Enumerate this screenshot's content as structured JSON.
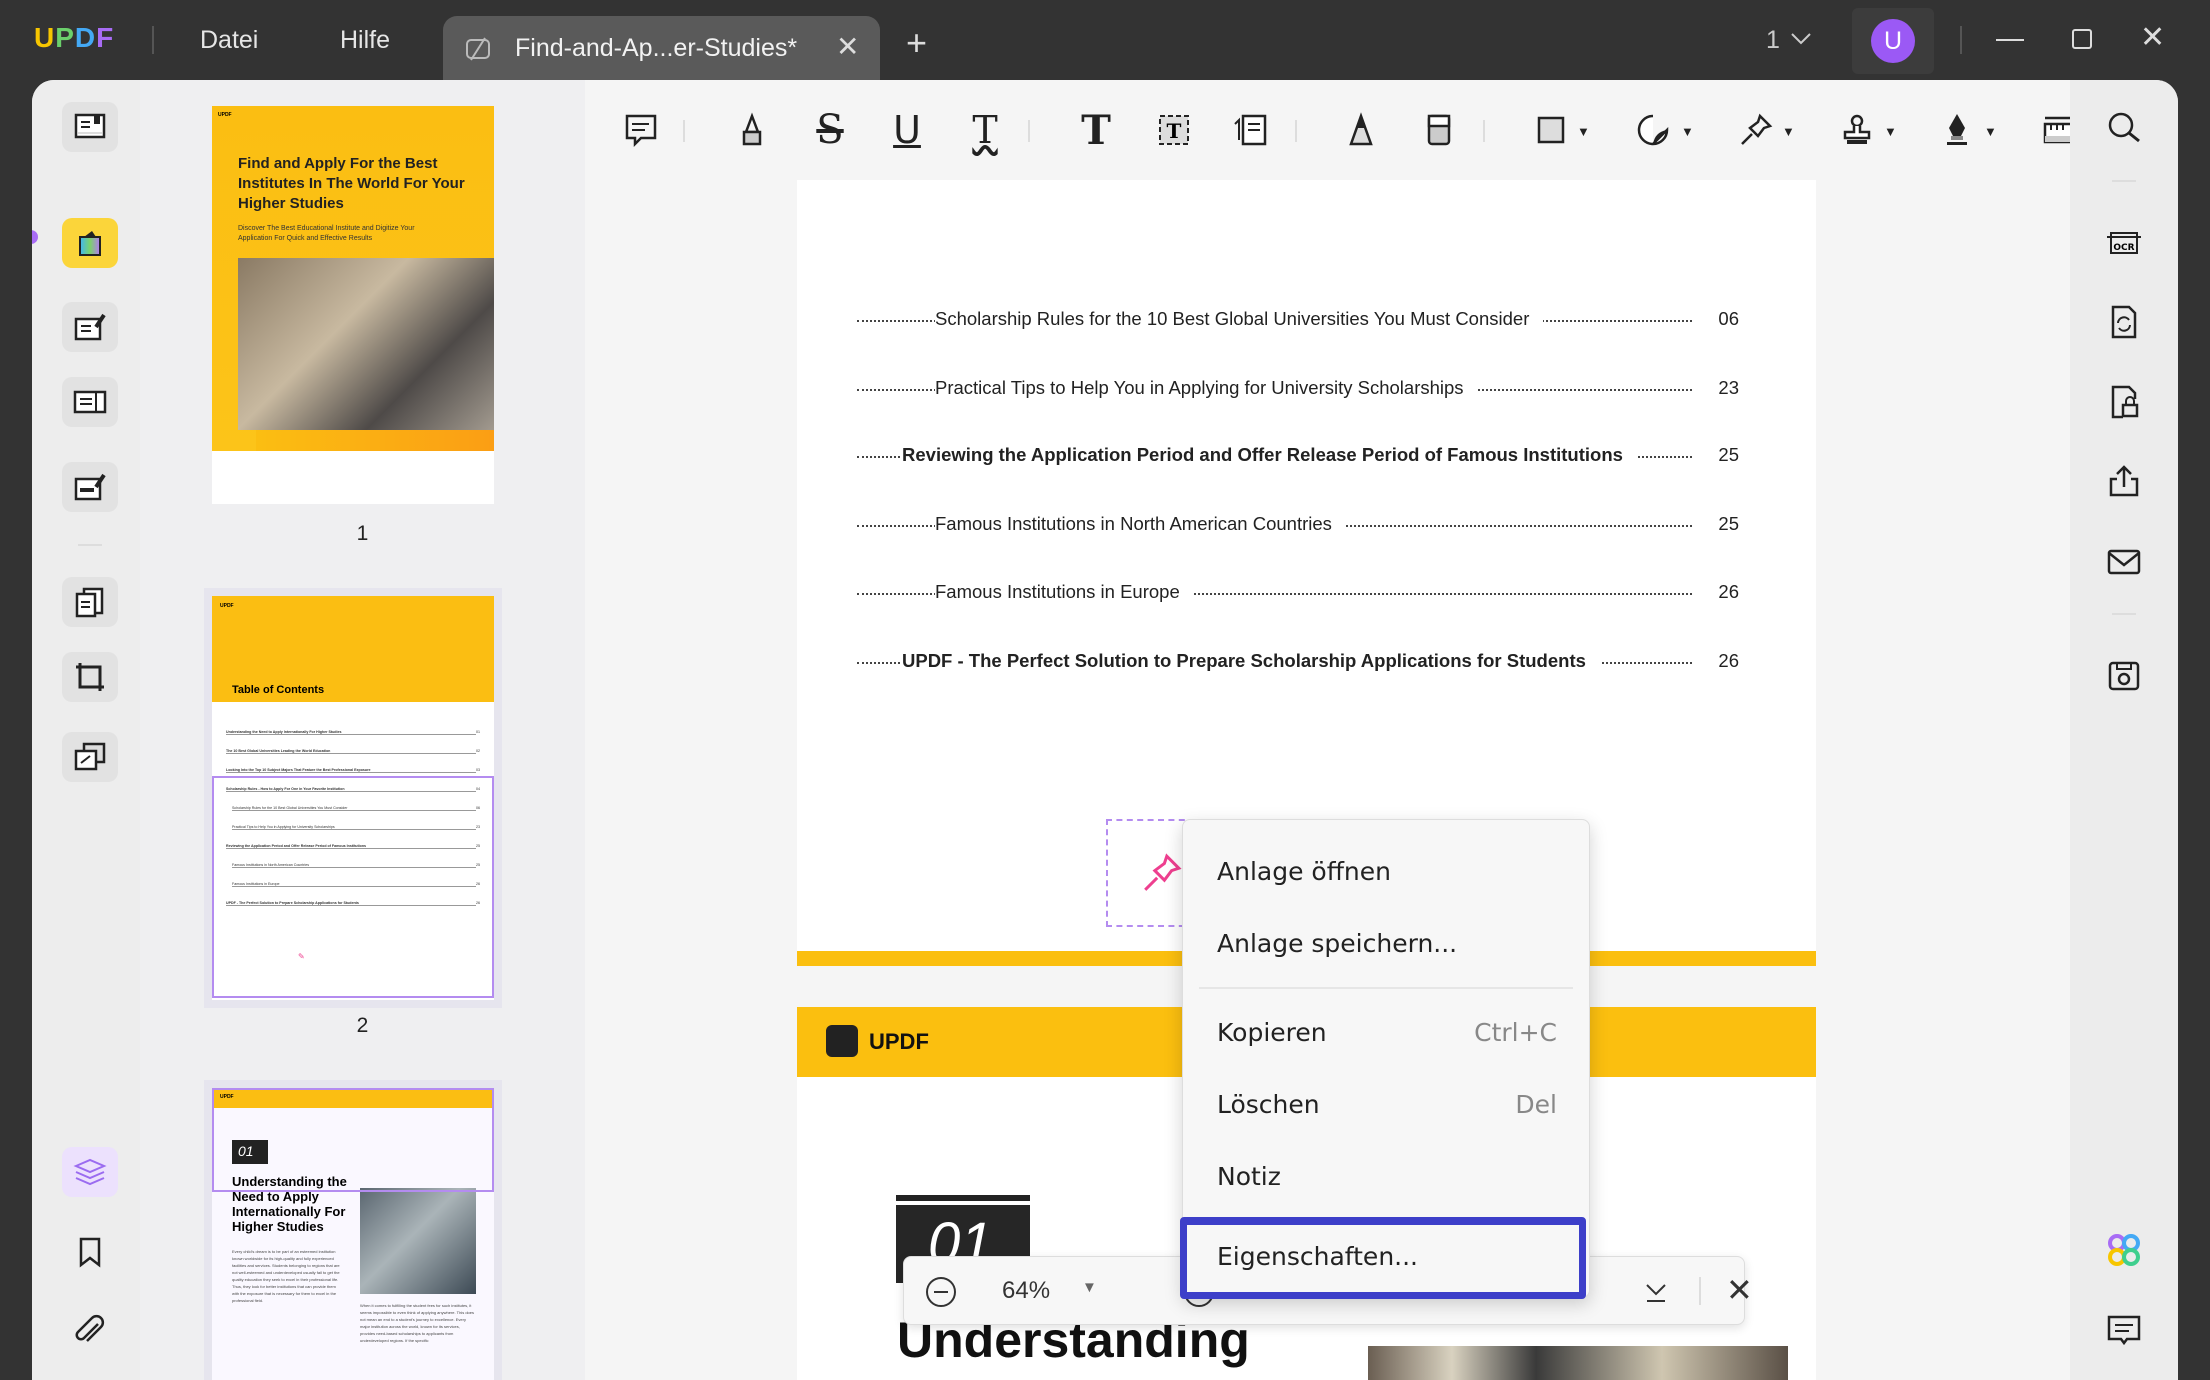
{
  "titlebar": {
    "logo": [
      "U",
      "P",
      "D",
      "F"
    ],
    "menu_file": "Datei",
    "menu_help": "Hilfe",
    "tab_title": "Find-and-Ap...er-Studies*",
    "page_indicator": "1",
    "avatar_letter": "U",
    "avatar_color": "#9b59f5"
  },
  "thumbnails": {
    "page1": {
      "brand": "UPDF",
      "title": "Find and Apply For the Best Institutes In The World For Your Higher Studies",
      "subtitle": "Discover The Best Educational Institute and Digitize Your Application For Quick and Effective Results",
      "label": "1"
    },
    "page2": {
      "brand": "UPDF",
      "title": "Table of Contents",
      "rows": [
        {
          "t": "Understanding the Need to Apply Internationally For Higher Studies",
          "n": "01"
        },
        {
          "t": "The 10 Best Global Universities Leading the World Education",
          "n": "02"
        },
        {
          "t": "Looking Into the Top 10 Subject Majors That Feature the Best Professional Exposure",
          "n": "03"
        },
        {
          "t": "Scholarship Rules - How to Apply For One in Your Favorite Institution",
          "n": "04"
        },
        {
          "t": "Scholarship Rules for the 10 Best Global Universities You Must Consider",
          "n": "06"
        },
        {
          "t": "Practical Tips to Help You in Applying for University Scholarships",
          "n": "23"
        },
        {
          "t": "Reviewing the Application Period and Offer Release Period of Famous Institutions",
          "n": "25"
        },
        {
          "t": "Famous Institutions in North American Countries",
          "n": "25"
        },
        {
          "t": "Famous Institutions in Europe",
          "n": "26"
        },
        {
          "t": "UPDF - The Perfect Solution to Prepare Scholarship Applications for Students",
          "n": "26"
        }
      ],
      "label": "2"
    },
    "page3": {
      "brand": "UPDF",
      "number": "01",
      "title": "Understanding the Need to Apply Internationally For Higher Studies",
      "para1": "Every child's dream is to be part of an esteemed institution known worldwide for its high-quality and fully experienced facilities and services. Students belonging to regions that are not well-esteemed and underdeveloped usually fail to get the quality education they seek to excel in their professional life. Thus, they look for better institutions that can provide them with the exposure that is necessary for them to excel in the professional field.",
      "para2": "When it comes to fulfilling the student fees for such institutes, it seems impossible to even think of applying anywhere. This does not mean an end to a student's journey to excellence. Every major institution across the world, known for its services, provides need-based scholarships to applicants from underdeveloped regions. If the specific"
    }
  },
  "document": {
    "toc": [
      {
        "t": "Scholarship Rules for the 10 Best Global Universities You Must Consider",
        "n": "06",
        "bold": false
      },
      {
        "t": "Practical Tips to Help You in Applying for University Scholarships",
        "n": "23",
        "bold": false
      },
      {
        "t": "Reviewing the Application Period and Offer Release Period of Famous Institutions",
        "n": "25",
        "bold": true
      },
      {
        "t": "Famous Institutions in North American Countries",
        "n": "25",
        "bold": false
      },
      {
        "t": "Famous Institutions in Europe",
        "n": "26",
        "bold": false
      },
      {
        "t": "UPDF - The Perfect Solution to Prepare Scholarship Applications for Students",
        "n": "26",
        "bold": true
      }
    ],
    "page2_brand": "UPDF",
    "chapter_number": "01",
    "chapter_title": "Understanding"
  },
  "context_menu": {
    "items": [
      {
        "label": "Anlage öffnen",
        "shortcut": ""
      },
      {
        "label": "Anlage speichern...",
        "shortcut": ""
      },
      {
        "label": "Kopieren",
        "shortcut": "Ctrl+C"
      },
      {
        "label": "Löschen",
        "shortcut": "Del"
      },
      {
        "label": "Notiz",
        "shortcut": ""
      },
      {
        "label": "Eigenschaften...",
        "shortcut": ""
      }
    ],
    "highlight_color": "#3d3fc9"
  },
  "zoom": {
    "value": "64%"
  },
  "colors": {
    "accent": "#fbbf0f",
    "selection": "#b48cf0",
    "pin": "#ee3f8f"
  }
}
